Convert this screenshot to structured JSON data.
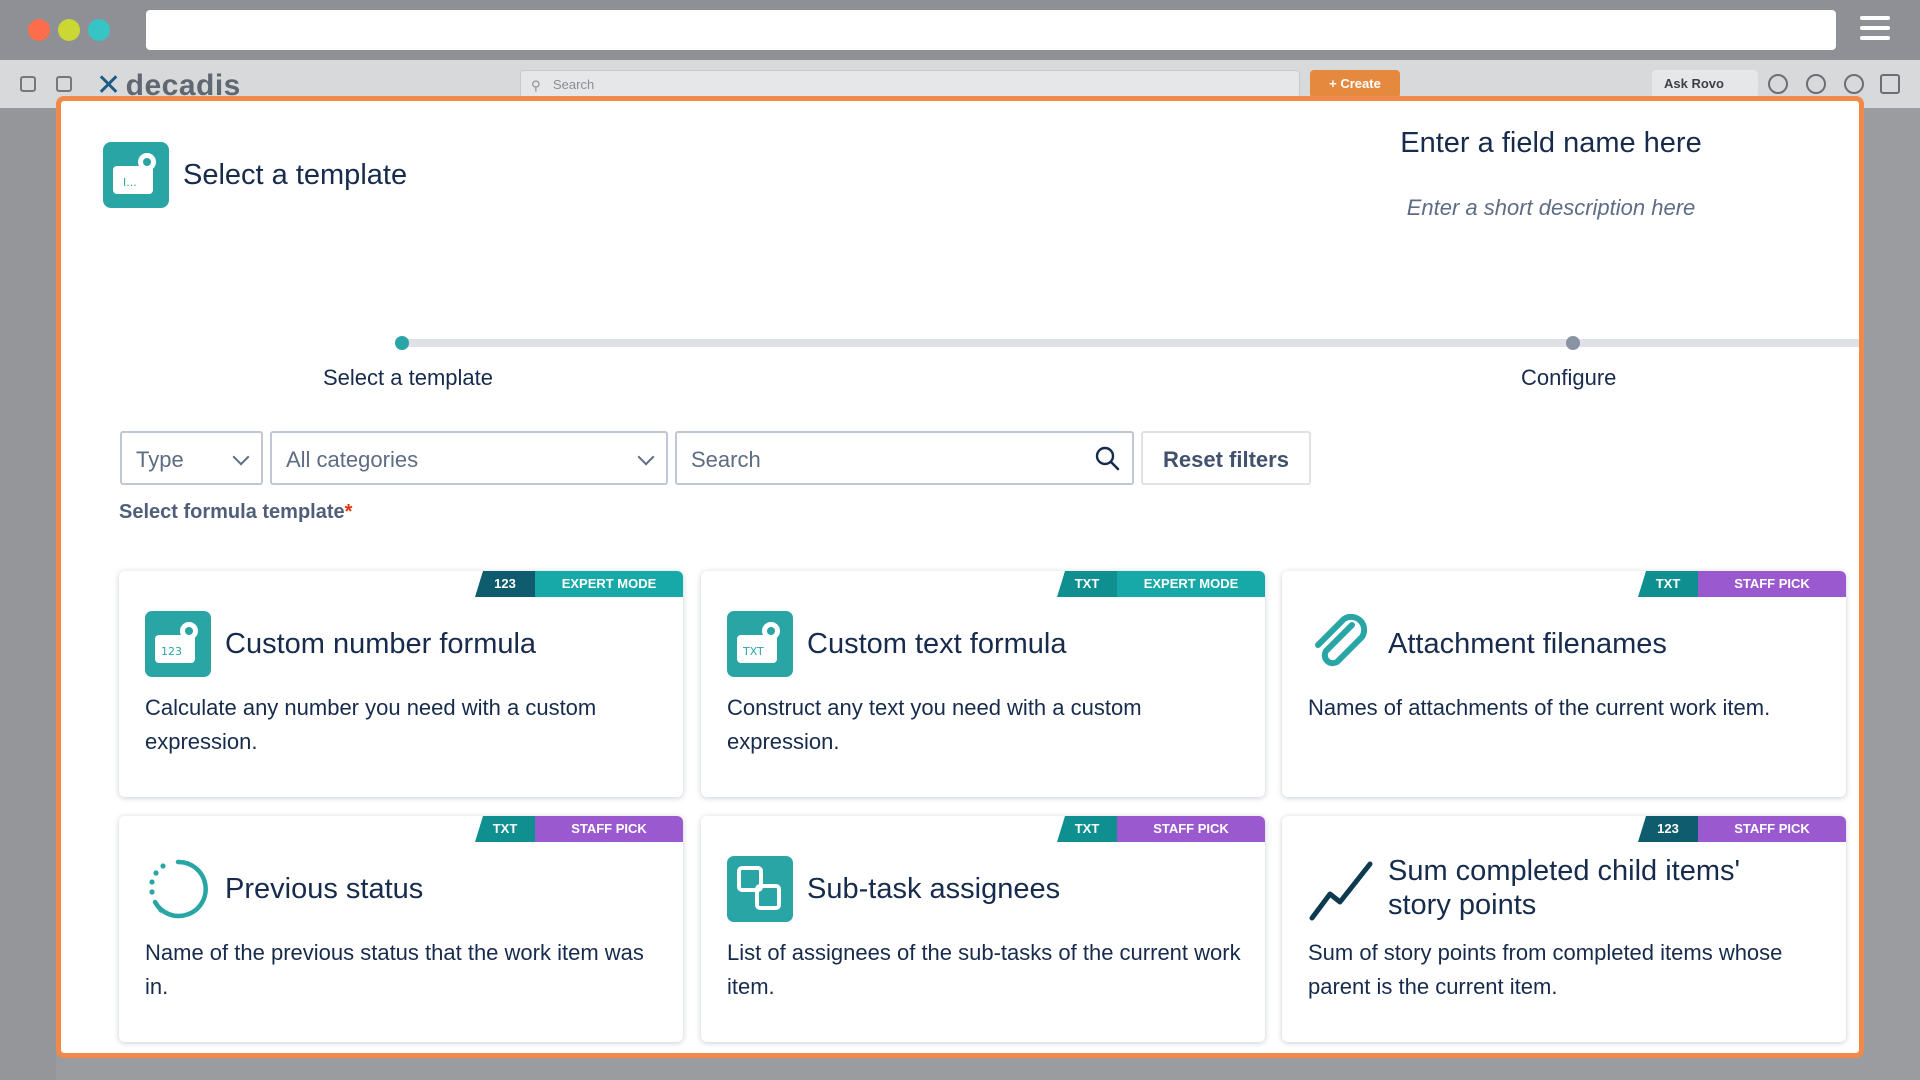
{
  "app": {
    "logo": "decadis",
    "search_placeholder": "Search",
    "create_label": "+ Create",
    "ask_rovo_label": "Ask Rovo"
  },
  "modal": {
    "title": "Select a template",
    "field_name": "Enter a field name here",
    "field_description": "Enter a short description here",
    "steps": [
      {
        "label": "Select a template",
        "active": true
      },
      {
        "label": "Configure",
        "active": false
      }
    ],
    "filters": {
      "type_label": "Type",
      "category_label": "All categories",
      "search_placeholder": "Search",
      "reset_label": "Reset filters"
    },
    "select_label": "Select formula template",
    "required_mark": "*",
    "cards": [
      {
        "type_tag": "123",
        "mode_tag": "EXPERT MODE",
        "title": "Custom number formula",
        "description": "Calculate any number you need with a custom expression.",
        "icon": "calculator-cog-icon",
        "icon_text": "123"
      },
      {
        "type_tag": "TXT",
        "mode_tag": "EXPERT MODE",
        "title": "Custom text formula",
        "description": "Construct any text you need with a custom expression.",
        "icon": "text-cog-icon",
        "icon_text": "TXT"
      },
      {
        "type_tag": "TXT",
        "mode_tag": "STAFF PICK",
        "title": "Attachment filenames",
        "description": "Names of attachments of the current work item.",
        "icon": "paperclip-icon"
      },
      {
        "type_tag": "TXT",
        "mode_tag": "STAFF PICK",
        "title": "Previous status",
        "description": "Name of the previous status that the work item was in.",
        "icon": "dashed-circle-icon"
      },
      {
        "type_tag": "TXT",
        "mode_tag": "STAFF PICK",
        "title": "Sub-task assignees",
        "description": "List of assignees of the sub-tasks of the current work item.",
        "icon": "subtask-icon"
      },
      {
        "type_tag": "123",
        "mode_tag": "STAFF PICK",
        "title": "Sum completed child items' story points",
        "description": "Sum of story points from completed items whose parent is the current item.",
        "icon": "trend-line-icon"
      }
    ]
  },
  "colors": {
    "accent": "#2aa5a5",
    "staff_pick": "#9b59d0",
    "modal_border": "#f0894a"
  }
}
